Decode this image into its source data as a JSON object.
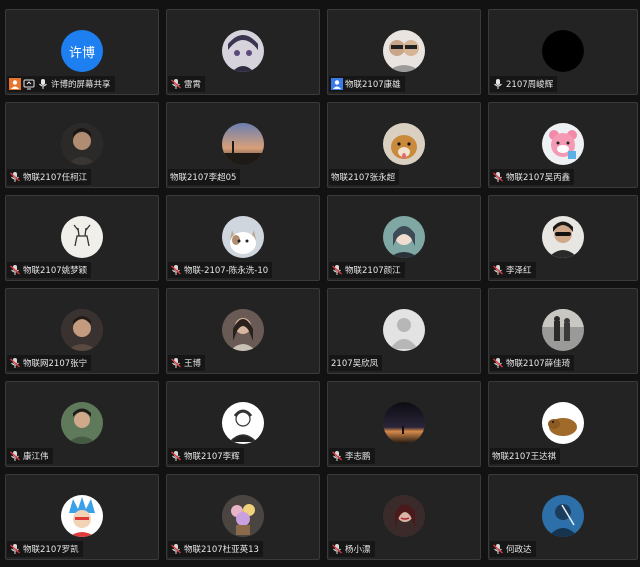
{
  "participants": [
    {
      "name": "许博的屏幕共享",
      "avatar_text": "许博",
      "avatar_style": "blue-text",
      "icons": [
        "user-orange-icon",
        "screen-share-icon",
        "mic-icon"
      ]
    },
    {
      "name": "雷霄",
      "avatar_style": "anime-boy",
      "icons": [
        "mic-muted-icon"
      ]
    },
    {
      "name": "物联2107康雄",
      "avatar_style": "couple-photo",
      "icons": [
        "user-blue-icon"
      ]
    },
    {
      "name": "2107周峻辉",
      "avatar_style": "black",
      "icons": [
        "mic-icon"
      ]
    },
    {
      "name": "物联2107任柯江",
      "avatar_style": "portrait-dark",
      "icons": [
        "mic-muted-icon"
      ]
    },
    {
      "name": "物联2107李超05",
      "avatar_style": "sunset",
      "icons": []
    },
    {
      "name": "物联2107张永超",
      "avatar_style": "dog",
      "icons": []
    },
    {
      "name": "物联2107吴丙鑫",
      "avatar_style": "pink-bear",
      "icons": [
        "mic-muted-icon"
      ]
    },
    {
      "name": "物联2107姚梦颖",
      "avatar_style": "deer",
      "icons": [
        "mic-muted-icon"
      ]
    },
    {
      "name": "物联-2107-陈永洗-10",
      "avatar_style": "cat",
      "icons": [
        "mic-muted-icon"
      ]
    },
    {
      "name": "物联2107颜江",
      "avatar_style": "anime-teal",
      "icons": [
        "mic-muted-icon"
      ]
    },
    {
      "name": "李泽红",
      "avatar_style": "sunglasses",
      "icons": [
        "mic-muted-icon"
      ]
    },
    {
      "name": "物联网2107张宁",
      "avatar_style": "portrait-warm",
      "icons": [
        "mic-muted-icon"
      ]
    },
    {
      "name": "王博",
      "avatar_style": "portrait-girl",
      "icons": [
        "mic-muted-icon"
      ]
    },
    {
      "name": "2107吴欣凤",
      "avatar_style": "default-user",
      "icons": []
    },
    {
      "name": "物联2107薛佳琦",
      "avatar_style": "street",
      "icons": [
        "mic-muted-icon"
      ]
    },
    {
      "name": "康江伟",
      "avatar_style": "portrait-green",
      "icons": [
        "mic-muted-icon"
      ]
    },
    {
      "name": "物联2107李辉",
      "avatar_style": "sketch-man",
      "icons": [
        "mic-muted-icon"
      ]
    },
    {
      "name": "李志鹏",
      "avatar_style": "night-sky",
      "icons": [
        "mic-muted-icon"
      ]
    },
    {
      "name": "物联2107王达祺",
      "avatar_style": "capybara",
      "icons": []
    },
    {
      "name": "物联2107罗凯",
      "avatar_style": "goku",
      "icons": [
        "mic-muted-icon"
      ]
    },
    {
      "name": "物联2107杜亚英13",
      "avatar_style": "flowers",
      "icons": [
        "mic-muted-icon"
      ]
    },
    {
      "name": "杨小漂",
      "avatar_style": "girl-red",
      "icons": [
        "mic-muted-icon"
      ]
    },
    {
      "name": "何政达",
      "avatar_style": "blue-art",
      "icons": [
        "mic-muted-icon"
      ]
    }
  ],
  "colors": {
    "background": "#121212",
    "tile": "#232323",
    "tile_border": "#3a3a3a",
    "accent_blue": "#1e7ff0",
    "muted_red": "#e0393e"
  }
}
